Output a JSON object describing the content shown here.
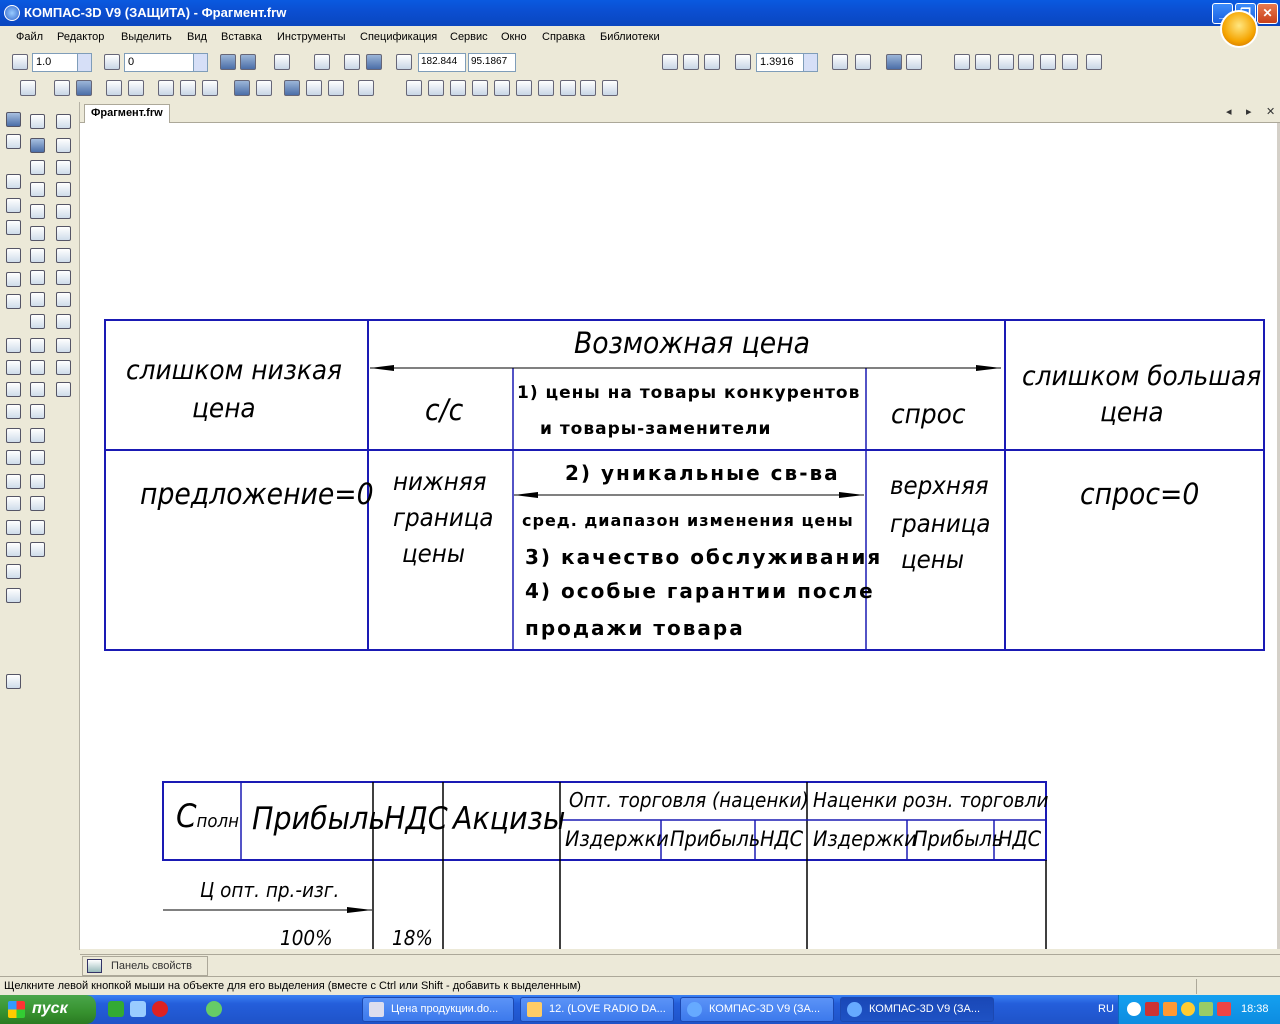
{
  "window": {
    "title": "КОМПАС-3D V9 (ЗАЩИТА) - Фрагмент.frw"
  },
  "menu": [
    "Файл",
    "Редактор",
    "Выделить",
    "Вид",
    "Вставка",
    "Инструменты",
    "Спецификация",
    "Сервис",
    "Окно",
    "Справка",
    "Библиотеки"
  ],
  "toolbar": {
    "step": "1.0",
    "layer": "0",
    "coord_x": "182.844",
    "coord_y": "95.1867",
    "zoom": "1.3916"
  },
  "doc_tab": "Фрагмент.frw",
  "drawing": {
    "table1": {
      "too_low": [
        "слишком низкая",
        "цена"
      ],
      "possible_price": "Возможная цена",
      "too_high": [
        "слишком большая",
        "цена"
      ],
      "cost": "с/с",
      "demand": "спрос",
      "item1_a": "1) цены на товары конкурентов",
      "item1_b": "и товары-заменители",
      "supply_zero": "предложение=0",
      "lower_bound": [
        "нижняя",
        "граница",
        "цены"
      ],
      "item2": "2) уникальные св-ва",
      "range_note": "сред. диапазон изменения цены",
      "item3": "3) качество обслуживания",
      "item4_a": "4) особые гарантии после",
      "item4_b": "продажи товара",
      "upper_bound": [
        "верхняя",
        "граница",
        "цены"
      ],
      "demand_zero": "спрос=0"
    },
    "table2": {
      "c": "С",
      "c_sub": "полн",
      "profit": "Прибыль",
      "vat": "НДС",
      "excise": "Акцизы",
      "wholesale": "Опт. торговля (наценки)",
      "retail": "Наценки розн. торговли",
      "costs": "Издержки",
      "profit_small": "Прибыль",
      "vat_small": "НДС",
      "price_note": "Ц опт. пр.-изг.",
      "pct100": "100%",
      "pct18": "18%"
    }
  },
  "properties_panel": "Панель свойств",
  "status": "Щелкните левой кнопкой мыши на объекте для его выделения (вместе с Ctrl или Shift - добавить к выделенным)",
  "taskbar": {
    "start": "пуск",
    "tasks": [
      "Цена продукции.do...",
      "12.  (LOVE RADIO DA...",
      "КОМПАС-3D V9 (ЗА...",
      "КОМПАС-3D V9 (ЗА..."
    ],
    "lang": "RU",
    "time": "18:38"
  },
  "colors": {
    "table_border": "#1a1ab4",
    "titlebar": "#0a5ae0",
    "taskbar": "#245edb",
    "start": "#36912e"
  }
}
